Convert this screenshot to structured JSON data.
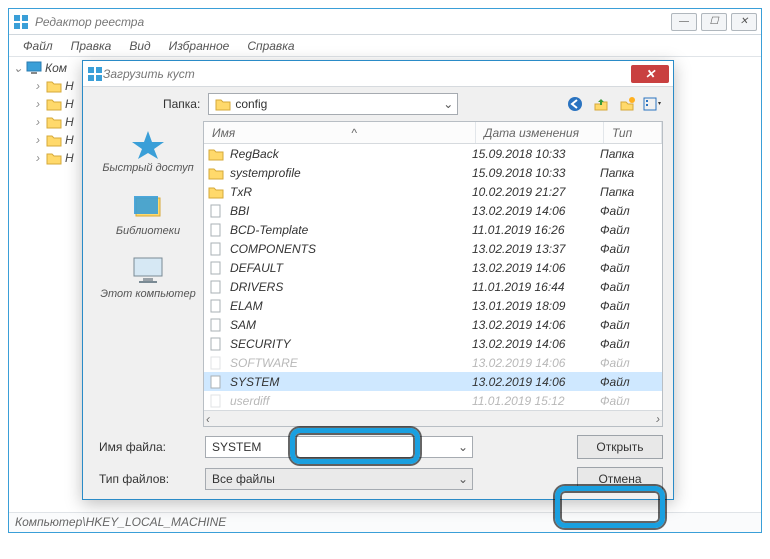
{
  "main": {
    "title": "Редактор реестра",
    "menu": [
      "Файл",
      "Правка",
      "Вид",
      "Избранное",
      "Справка"
    ],
    "tree_root": "Ком",
    "tree_children": [
      "H",
      "H",
      "H",
      "H",
      "H"
    ],
    "statusbar": "Компьютер\\HKEY_LOCAL_MACHINE"
  },
  "dialog": {
    "title": "Загрузить куст",
    "folder_label": "Папка:",
    "folder_value": "config",
    "places": [
      {
        "label": "Быстрый доступ"
      },
      {
        "label": "Библиотеки"
      },
      {
        "label": "Этот компьютер"
      }
    ],
    "columns": {
      "name": "Имя",
      "date": "Дата изменения",
      "type": "Тип"
    },
    "rows": [
      {
        "name": "RegBack",
        "date": "15.09.2018 10:33",
        "type": "Папка",
        "kind": "folder"
      },
      {
        "name": "systemprofile",
        "date": "15.09.2018 10:33",
        "type": "Папка",
        "kind": "folder"
      },
      {
        "name": "TxR",
        "date": "10.02.2019 21:27",
        "type": "Папка",
        "kind": "folder"
      },
      {
        "name": "BBI",
        "date": "13.02.2019 14:06",
        "type": "Файл",
        "kind": "file"
      },
      {
        "name": "BCD-Template",
        "date": "11.01.2019 16:26",
        "type": "Файл",
        "kind": "file"
      },
      {
        "name": "COMPONENTS",
        "date": "13.02.2019 13:37",
        "type": "Файл",
        "kind": "file"
      },
      {
        "name": "DEFAULT",
        "date": "13.02.2019 14:06",
        "type": "Файл",
        "kind": "file"
      },
      {
        "name": "DRIVERS",
        "date": "11.01.2019 16:44",
        "type": "Файл",
        "kind": "file"
      },
      {
        "name": "ELAM",
        "date": "13.01.2019 18:09",
        "type": "Файл",
        "kind": "file"
      },
      {
        "name": "SAM",
        "date": "13.02.2019 14:06",
        "type": "Файл",
        "kind": "file"
      },
      {
        "name": "SECURITY",
        "date": "13.02.2019 14:06",
        "type": "Файл",
        "kind": "file"
      },
      {
        "name": "SOFTWARE",
        "date": "13.02.2019 14:06",
        "type": "Файл",
        "kind": "file",
        "hidden_by_highlight": true
      },
      {
        "name": "SYSTEM",
        "date": "13.02.2019 14:06",
        "type": "Файл",
        "kind": "file",
        "selected": true
      },
      {
        "name": "userdiff",
        "date": "11.01.2019 15:12",
        "type": "Файл",
        "kind": "file",
        "hidden_by_highlight": true
      }
    ],
    "filename_label": "Имя файла:",
    "filename_value": "SYSTEM",
    "filetype_label": "Тип файлов:",
    "filetype_value": "Все файлы",
    "open_label": "Открыть",
    "cancel_label": "Отмена"
  }
}
